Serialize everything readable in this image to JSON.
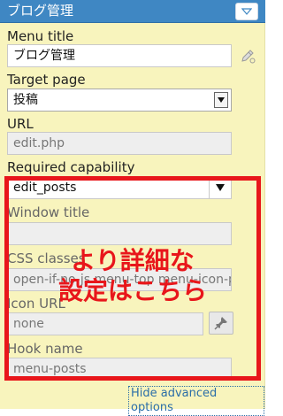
{
  "header": {
    "title": "ブログ管理"
  },
  "fields": {
    "menu_title": {
      "label": "Menu title",
      "value": "ブログ管理"
    },
    "target_page": {
      "label": "Target page",
      "value": "投稿"
    },
    "url": {
      "label": "URL",
      "value": "edit.php"
    },
    "required_capability": {
      "label": "Required capability",
      "value": "edit_posts"
    },
    "window_title": {
      "label": "Window title",
      "value": ""
    },
    "css_classes": {
      "label": "CSS classes",
      "value": "open-if-no-js menu-top menu-icon-post"
    },
    "icon_url": {
      "label": "Icon URL",
      "value": "none"
    },
    "hook_name": {
      "label": "Hook name",
      "value": "menu-posts"
    }
  },
  "overlay": {
    "line1": "より詳細な",
    "line2": "設定はこちら"
  },
  "footer": {
    "hide_advanced": "Hide advanced options"
  },
  "colors": {
    "header_bg": "#3f87c3",
    "panel_bg": "#f8f4bd",
    "highlight_red": "#e8161b",
    "link": "#2b6ea8"
  }
}
